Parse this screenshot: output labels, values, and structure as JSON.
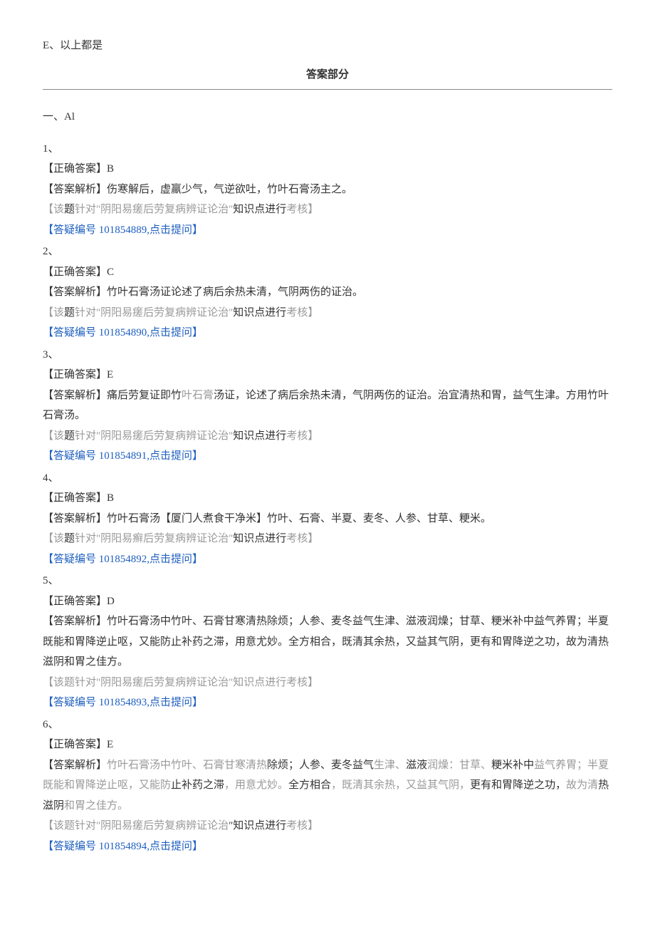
{
  "optionE": "E、以上都是",
  "sectionTitle": "答案部分",
  "sectionHead": "一、Al",
  "questions": [
    {
      "num": "1、",
      "ansLabel": "【正确答案】",
      "ansValue": "B",
      "expLabel": "【答案解析】",
      "expText": "伤寒解后，虚羸少气，气逆欲吐，竹叶石膏汤主之。",
      "kpPrefix": "【该",
      "kpBold1": "题",
      "kpGray2": "针对\"",
      "kpTitle": "阴阳易瘥后劳复病辨证论治",
      "kpGray3": "\"",
      "kpBold2": "知识点进行",
      "kpGray4": "考核",
      "kpSuffix": "】",
      "link": "【答疑编号 101854889,点击提问】"
    },
    {
      "num": "2、",
      "ansLabel": "【正确答案】",
      "ansValue": "C",
      "expLabel": "【答案解析】",
      "expText": "竹叶石膏汤证论述了病后余热未清，气阴两伤的证治。",
      "kpPrefix": "【该",
      "kpBold1": "题",
      "kpGray2": "针对\"",
      "kpTitle": "阴阳易瘥后劳复病辨证论治",
      "kpGray3": "\"",
      "kpBold2": "知识点进行",
      "kpGray4": "考核",
      "kpSuffix": "】",
      "link": "【答疑编号 101854890,点击提问】"
    },
    {
      "num": "3、",
      "ansLabel": "【正确答案】",
      "ansValue": "E",
      "expLabel": "【答案解析】",
      "expBlack1": "痛后劳复证即竹",
      "expGray1": "叶石膏",
      "expBlack2": "汤证，论述了病后余热未清，气阴两伤的证治。治宜清热和胃，益气生津。方用竹叶石膏汤。",
      "kpPrefix": "【该",
      "kpBold1": "题",
      "kpGray2": "针对\"",
      "kpTitle": "阴阳易瘥后劳复病辨证论治",
      "kpGray3": "\"",
      "kpBold2": "知识点进行",
      "kpGray4": "考核",
      "kpSuffix": "】",
      "link": "【答疑编号 101854891,点击提问】"
    },
    {
      "num": "4、",
      "ansLabel": "【正确答案】",
      "ansValue": "B",
      "expLabel": "【答案解析】",
      "expBlack1": "竹叶石膏汤【厦门人煮食干净米】竹叶、石膏、半夏、麦冬、人参、甘草、粳米。",
      "kpPrefix": "【该",
      "kpBold1": "题",
      "kpGray2": "针对\"",
      "kpTitle": "阴阳易癣后劳复病辨证论治",
      "kpGray3": "\"",
      "kpBold2": "知识点进行",
      "kpGray4": "考核",
      "kpSuffix": "】",
      "link": "【答疑编号 101854892,点击提问】"
    },
    {
      "num": "5、",
      "ansLabel": "【正确答案】",
      "ansValue": "D",
      "expLabel": "【答案解析】",
      "expBlack1": "竹叶石膏汤中竹叶、石膏甘寒清热除烦；人参、麦冬益气生津、滋液润燥；甘草、粳米补中益气养胃；半夏既能和胃降逆止呕，又能防止补药之滞，用意尤妙。全方相合，既清其余热，又益其气阴，更有和胃降逆之功，故为清热滋阴和胃之佳方。",
      "kpPrefix": "【该题针对\"",
      "kpTitle": "阴阳易瘥后劳复病辨证论治",
      "kpMid": "\"知识点进行",
      "kpGray4": "考核",
      "kpSuffix": "】",
      "link": "【答疑编号 101854893,点击提问】"
    },
    {
      "num": "6、",
      "ansLabel": "【正确答案】",
      "ansValue": "E",
      "expLabel": "【答案解析】",
      "seg1g": "竹叶石膏汤中竹叶、石膏甘寒清热",
      "seg1b": "除烦；人参、麦冬益气",
      "seg2g": "生津、",
      "seg2b": "滋液",
      "seg3g": "润燥：甘草、",
      "seg3b": "粳米补中",
      "seg4g": "益气养胃；半夏既能和胃降逆止呕，又能防",
      "seg4b": "止补药之滞",
      "seg5g": "，用意尤妙。",
      "seg5b": "全方相合",
      "seg6g": "，既清其余热，又益其气阴，",
      "seg6b": "更有和胃降逆之功，",
      "seg7g": "故为清",
      "seg7b": "热滋阴",
      "seg8g": "和胃之佳方。",
      "kpPrefix": "【该题针对\"",
      "kpTitle": "阴阳易瘥后劳复病辨证论治",
      "kpMid": "\"知识点进行",
      "kpGray4": "考核",
      "kpSuffix": "】",
      "link": "【答疑编号 101854894,点击提问】"
    }
  ]
}
